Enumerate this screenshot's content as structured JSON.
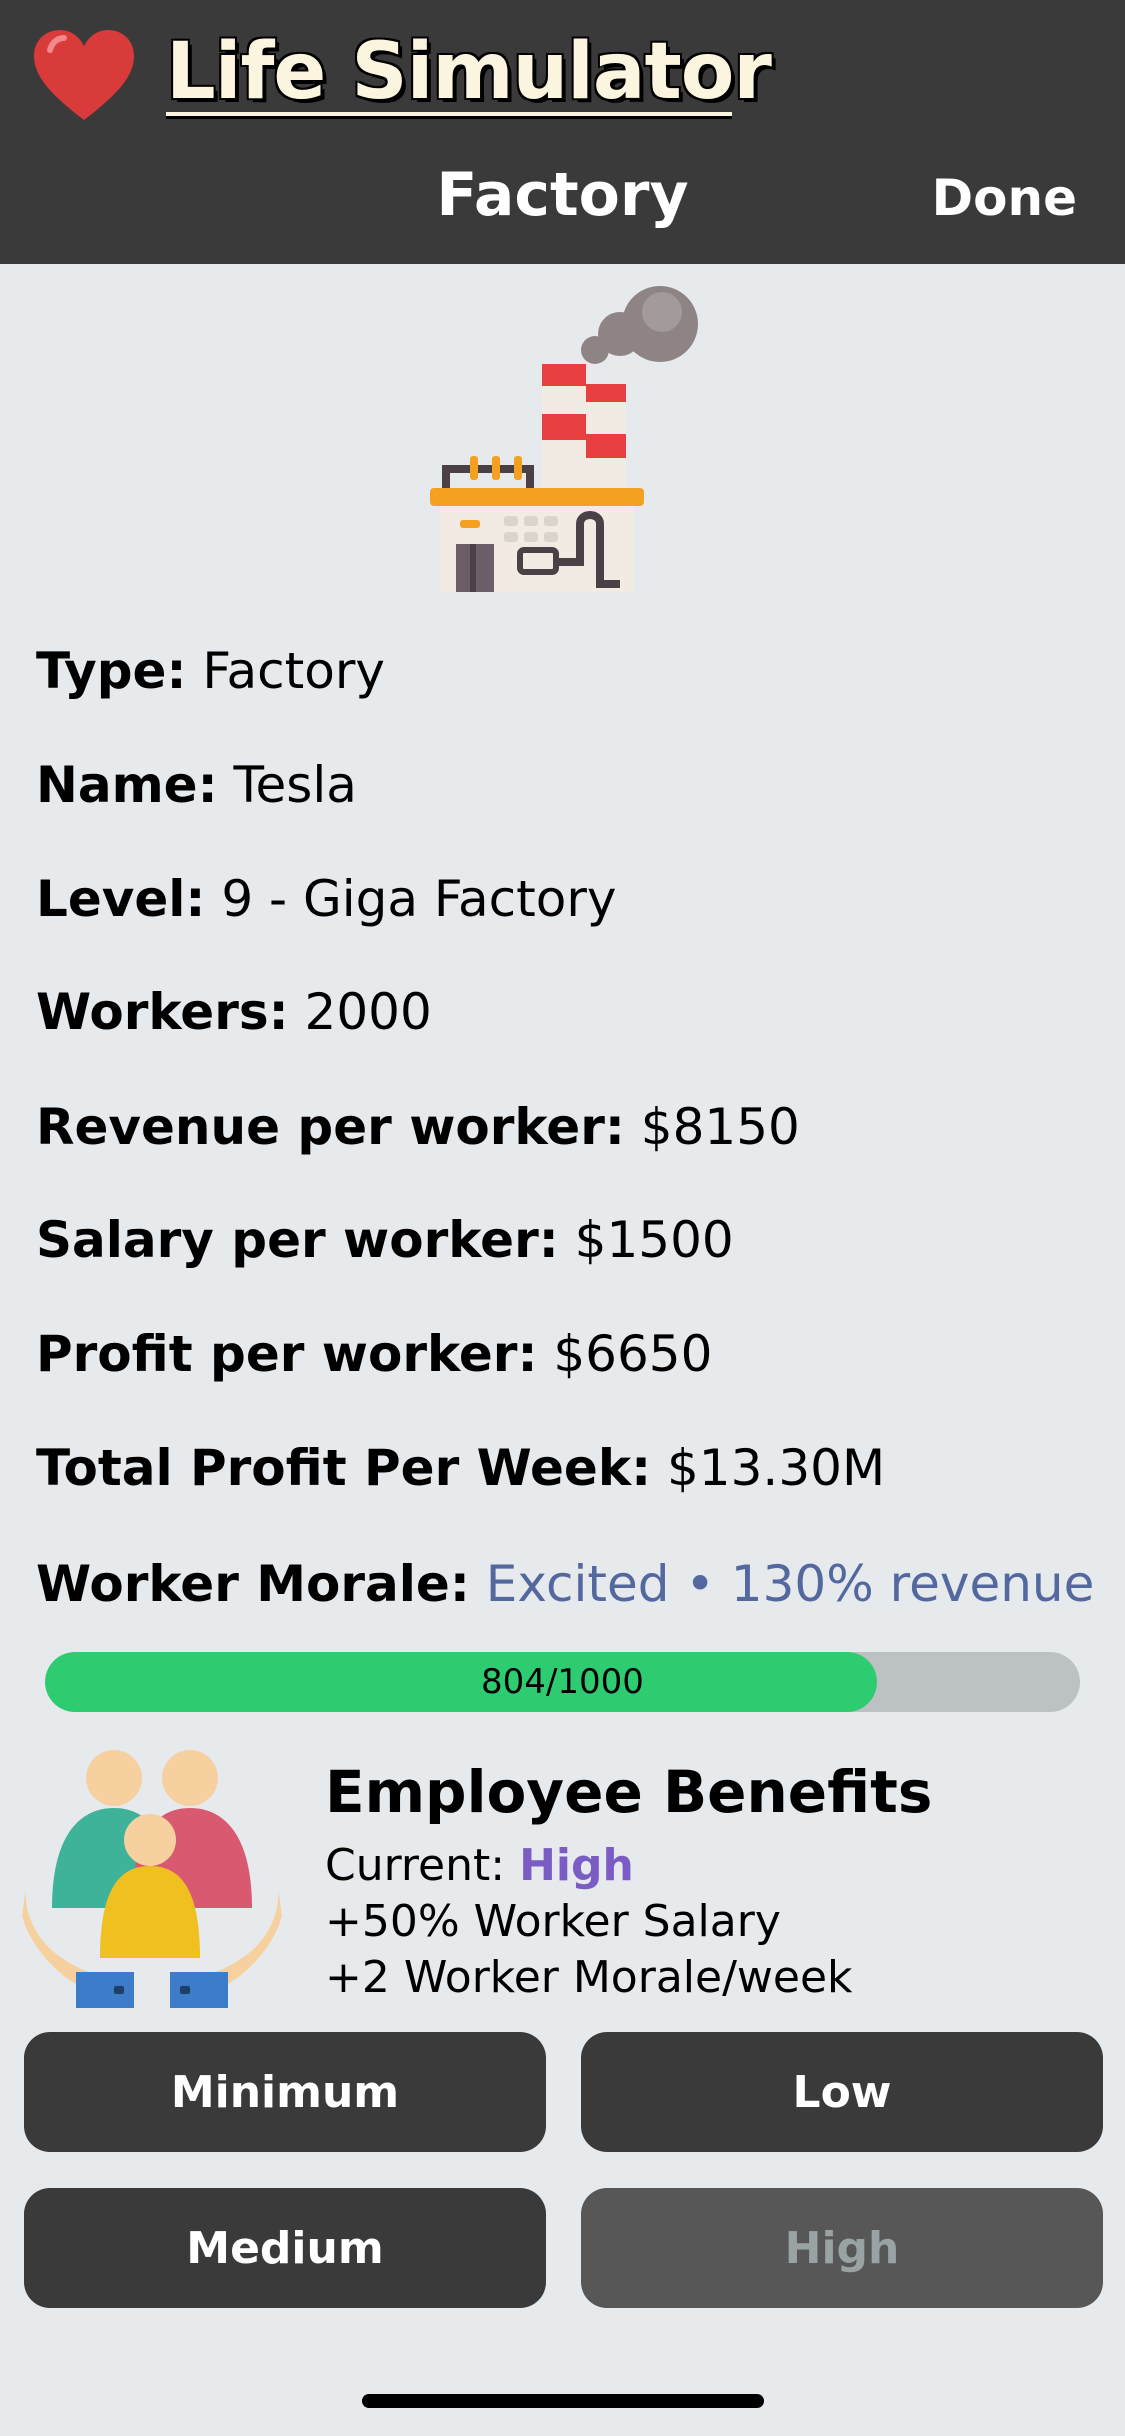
{
  "header": {
    "app_title": "Life Simulator",
    "screen_title": "Factory",
    "done_label": "Done",
    "app_icon": "heart-icon"
  },
  "details": {
    "type_label": "Type:",
    "type_value": "Factory",
    "name_label": "Name:",
    "name_value": "Tesla",
    "level_label": "Level:",
    "level_value": "9 - Giga Factory",
    "workers_label": "Workers:",
    "workers_value": "2000",
    "revenue_label": "Revenue per worker:",
    "revenue_value": "$8150",
    "salary_label": "Salary per worker:",
    "salary_value": "$1500",
    "profit_label": "Profit per worker:",
    "profit_value": "$6650",
    "total_label": "Total Profit Per Week:",
    "total_value": "$13.30M",
    "morale_label": "Worker Morale:",
    "morale_value": "Excited • 130% revenue"
  },
  "morale_bar": {
    "text": "804/1000",
    "current": 804,
    "max": 1000,
    "fill_color": "#2ecc71"
  },
  "benefits": {
    "title": "Employee Benefits",
    "current_label": "Current:",
    "current_value": "High",
    "line1": "+50% Worker Salary",
    "line2": "+2 Worker Morale/week",
    "icon": "family-hands-icon"
  },
  "buttons": {
    "minimum": "Minimum",
    "low": "Low",
    "medium": "Medium",
    "high": "High",
    "selected": "high"
  },
  "colors": {
    "header_bg": "#3a3a3a",
    "page_bg": "#e6eaed",
    "morale_text": "#5468a0",
    "benefit_current": "#7a5cc4"
  }
}
